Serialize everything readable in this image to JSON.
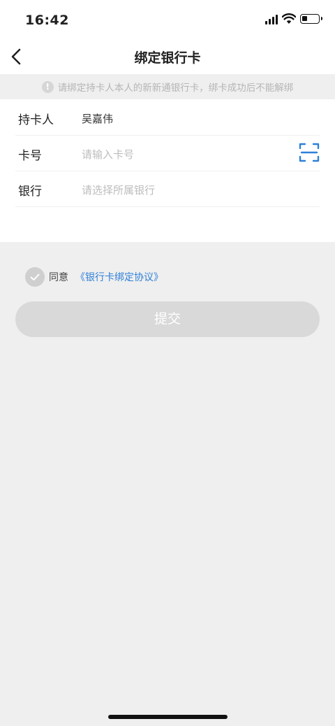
{
  "status": {
    "time": "16:42"
  },
  "nav": {
    "title": "绑定银行卡"
  },
  "notice": {
    "icon": "!",
    "text": "请绑定持卡人本人的新新通银行卡，绑卡成功后不能解绑"
  },
  "form": {
    "holder": {
      "label": "持卡人",
      "value": "吴嘉伟"
    },
    "card": {
      "label": "卡号",
      "placeholder": "请输入卡号"
    },
    "bank": {
      "label": "银行",
      "placeholder": "请选择所属银行"
    }
  },
  "agreement": {
    "text": "同意",
    "link": "《银行卡绑定协议》",
    "checked": true
  },
  "submit": {
    "label": "提交"
  },
  "colors": {
    "accent": "#2f80d8",
    "disabled_button": "#d9d9d9",
    "background": "#efefef"
  }
}
